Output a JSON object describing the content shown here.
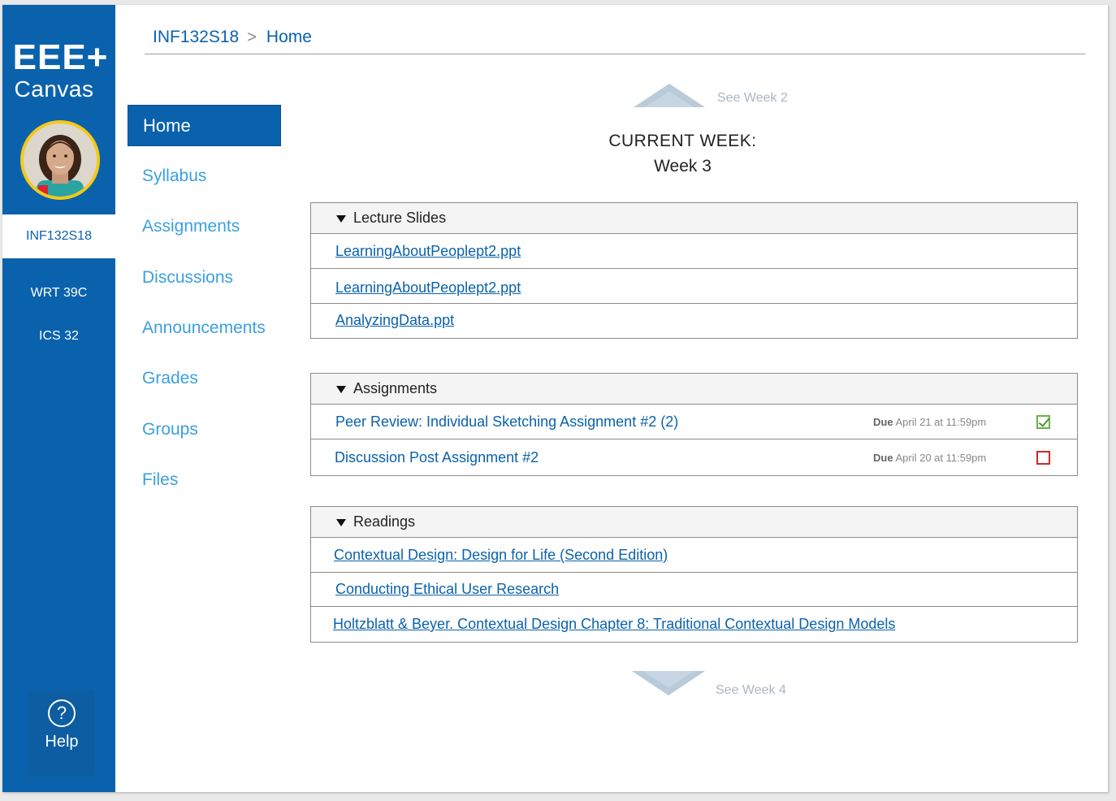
{
  "app": {
    "brand_line1": "EEE+",
    "brand_line2": "Canvas"
  },
  "rail": {
    "active_course": "INF132S18",
    "courses": [
      "WRT 39C",
      "ICS 32"
    ],
    "help_label": "Help",
    "help_glyph": "?"
  },
  "breadcrumb": {
    "course": "INF132S18",
    "separator": ">",
    "page": "Home"
  },
  "nav": {
    "items": [
      "Home",
      "Syllabus",
      "Assignments",
      "Discussions",
      "Announcements",
      "Grades",
      "Groups",
      "Files"
    ],
    "active": "Home"
  },
  "week": {
    "prev_label": "See Week 2",
    "current_label": "CURRENT WEEK:",
    "current_value": "Week 3",
    "next_label": "See Week 4"
  },
  "lecture_slides": {
    "title": "Lecture Slides",
    "items": [
      "LearningAboutPeoplept2.ppt",
      "LearningAboutPeoplept2.ppt",
      "AnalyzingData.ppt"
    ]
  },
  "assignments": {
    "title": "Assignments",
    "items": [
      {
        "name": "Peer Review: Individual Sketching Assignment #2 (2)",
        "due_prefix": "Due",
        "due_date": "April  21 at 11:59pm",
        "done": true
      },
      {
        "name": "Discussion Post Assignment #2",
        "due_prefix": "Due",
        "due_date": "April 20 at 11:59pm",
        "done": false
      }
    ]
  },
  "readings": {
    "title": "Readings",
    "items": [
      "Contextual Design: Design for Life (Second Edition)",
      "Conducting Ethical User Research",
      "Holtzblatt & Beyer. Contextual Design Chapter 8: Traditional Contextual Design Models"
    ]
  },
  "colors": {
    "brand_blue": "#0a62ad",
    "nav_link": "#3ba0e0",
    "avatar_ring": "#f5c916",
    "check_done": "#6ab14a",
    "check_pending": "#d42626"
  }
}
